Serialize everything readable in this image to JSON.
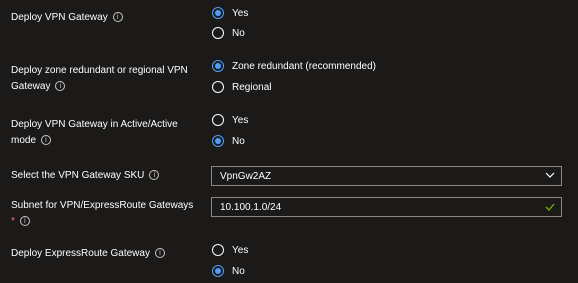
{
  "rows": {
    "vpn_gateway": {
      "label": "Deploy VPN Gateway",
      "options": [
        "Yes",
        "No"
      ],
      "selected": "Yes"
    },
    "zone_redundant": {
      "label_line1": "Deploy zone redundant or regional VPN",
      "label_line2": "Gateway",
      "options": [
        "Zone redundant (recommended)",
        "Regional"
      ],
      "selected": "Zone redundant (recommended)"
    },
    "active_active": {
      "label_line1": "Deploy VPN Gateway in Active/Active",
      "label_line2": "mode",
      "options": [
        "Yes",
        "No"
      ],
      "selected": "No"
    },
    "sku": {
      "label": "Select the VPN Gateway SKU",
      "value": "VpnGw2AZ"
    },
    "subnet": {
      "label_line1": "Subnet for VPN/ExpressRoute Gateways",
      "required_marker": "*",
      "value": "10.100.1.0/24"
    },
    "expressroute": {
      "label": "Deploy ExpressRoute Gateway",
      "options": [
        "Yes",
        "No"
      ],
      "selected": "No"
    }
  },
  "info_glyph": "i",
  "colors": {
    "background": "#1b1a19",
    "accent": "#4f9efd",
    "valid": "#6bb700",
    "border": "#8a8886"
  },
  "icons": [
    "info-icon",
    "chevron-down-icon",
    "checkmark-icon"
  ]
}
